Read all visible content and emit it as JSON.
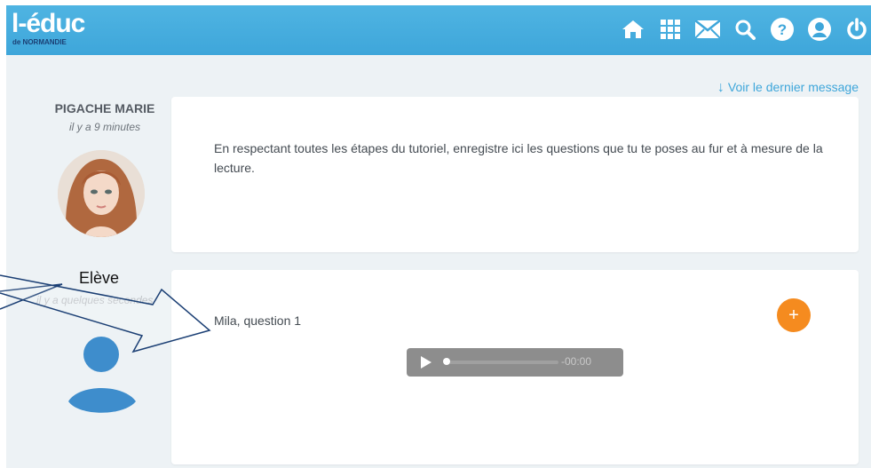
{
  "header": {
    "logo_main": "l-éduc",
    "logo_sub": "de NORMANDIE",
    "icons": [
      "home-icon",
      "apps-grid-icon",
      "mail-icon",
      "search-icon",
      "help-icon",
      "account-icon",
      "power-icon"
    ],
    "colors": {
      "bar": "#3ea6da",
      "logo_sub": "#1b3f74"
    }
  },
  "thread": {
    "last_message_link": "Voir le dernier message",
    "messages": [
      {
        "author": "PIGACHE MARIE",
        "time": "il y a 9 minutes",
        "text": "En respectant toutes les étapes du tutoriel, enregistre ici les questions que tu te poses au fur et à mesure de la lecture."
      },
      {
        "author": "Elève",
        "time": "il y a quelques secondes",
        "text": "Mila, question 1",
        "audio_time": "-00:00",
        "add_label": "+"
      }
    ]
  },
  "accent_colors": {
    "link": "#3ea6da",
    "add": "#f58b1f",
    "student_avatar": "#3e8dcc"
  }
}
